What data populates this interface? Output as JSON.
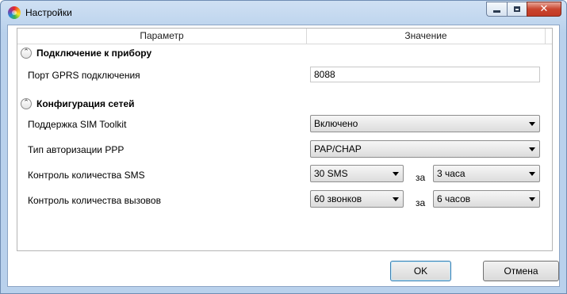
{
  "window": {
    "title": "Настройки"
  },
  "grid": {
    "headers": {
      "parameter": "Параметр",
      "value": "Значение"
    },
    "groups": [
      {
        "label": "Подключение к прибору",
        "expander_glyph": "⌃",
        "rows": [
          {
            "label": "Порт GPRS подключения",
            "value": "8088"
          }
        ]
      },
      {
        "label": "Конфигурация сетей",
        "expander_glyph": "⌃",
        "rows": [
          {
            "label": "Поддержка SIM Toolkit",
            "value": "Включено"
          },
          {
            "label": "Тип авторизации PPP",
            "value": "PAP/CHAP"
          },
          {
            "label": "Контроль количества SMS",
            "count": "30 SMS",
            "joiner": "за",
            "period": "3 часа"
          },
          {
            "label": "Контроль количества вызовов",
            "count": "60 звонков",
            "joiner": "за",
            "period": "6 часов"
          }
        ]
      }
    ]
  },
  "buttons": {
    "ok": "OK",
    "cancel": "Отмена"
  },
  "icons": {
    "app": "color-wheel-icon",
    "minimize": "minimize-icon",
    "maximize": "maximize-icon",
    "close": "close-icon",
    "close_glyph": "✕",
    "expander": "collapse-chevron-icon",
    "dropdown": "dropdown-arrow-icon"
  },
  "colors": {
    "close_button": "#c9452f",
    "frame": "#b9d1ec",
    "default_button_border": "#3c7fb1"
  }
}
